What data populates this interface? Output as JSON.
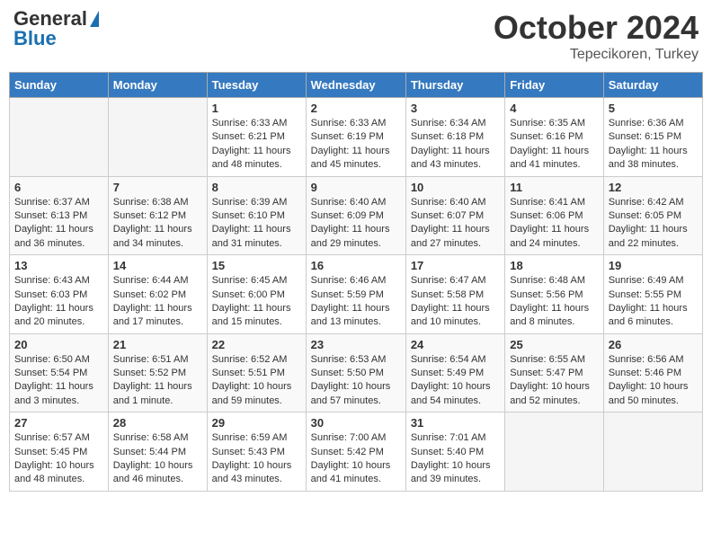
{
  "header": {
    "logo_general": "General",
    "logo_blue": "Blue",
    "month": "October 2024",
    "location": "Tepecikoren, Turkey"
  },
  "days_of_week": [
    "Sunday",
    "Monday",
    "Tuesday",
    "Wednesday",
    "Thursday",
    "Friday",
    "Saturday"
  ],
  "weeks": [
    [
      {
        "day": "",
        "sunrise": "",
        "sunset": "",
        "daylight": ""
      },
      {
        "day": "",
        "sunrise": "",
        "sunset": "",
        "daylight": ""
      },
      {
        "day": "1",
        "sunrise": "Sunrise: 6:33 AM",
        "sunset": "Sunset: 6:21 PM",
        "daylight": "Daylight: 11 hours and 48 minutes."
      },
      {
        "day": "2",
        "sunrise": "Sunrise: 6:33 AM",
        "sunset": "Sunset: 6:19 PM",
        "daylight": "Daylight: 11 hours and 45 minutes."
      },
      {
        "day": "3",
        "sunrise": "Sunrise: 6:34 AM",
        "sunset": "Sunset: 6:18 PM",
        "daylight": "Daylight: 11 hours and 43 minutes."
      },
      {
        "day": "4",
        "sunrise": "Sunrise: 6:35 AM",
        "sunset": "Sunset: 6:16 PM",
        "daylight": "Daylight: 11 hours and 41 minutes."
      },
      {
        "day": "5",
        "sunrise": "Sunrise: 6:36 AM",
        "sunset": "Sunset: 6:15 PM",
        "daylight": "Daylight: 11 hours and 38 minutes."
      }
    ],
    [
      {
        "day": "6",
        "sunrise": "Sunrise: 6:37 AM",
        "sunset": "Sunset: 6:13 PM",
        "daylight": "Daylight: 11 hours and 36 minutes."
      },
      {
        "day": "7",
        "sunrise": "Sunrise: 6:38 AM",
        "sunset": "Sunset: 6:12 PM",
        "daylight": "Daylight: 11 hours and 34 minutes."
      },
      {
        "day": "8",
        "sunrise": "Sunrise: 6:39 AM",
        "sunset": "Sunset: 6:10 PM",
        "daylight": "Daylight: 11 hours and 31 minutes."
      },
      {
        "day": "9",
        "sunrise": "Sunrise: 6:40 AM",
        "sunset": "Sunset: 6:09 PM",
        "daylight": "Daylight: 11 hours and 29 minutes."
      },
      {
        "day": "10",
        "sunrise": "Sunrise: 6:40 AM",
        "sunset": "Sunset: 6:07 PM",
        "daylight": "Daylight: 11 hours and 27 minutes."
      },
      {
        "day": "11",
        "sunrise": "Sunrise: 6:41 AM",
        "sunset": "Sunset: 6:06 PM",
        "daylight": "Daylight: 11 hours and 24 minutes."
      },
      {
        "day": "12",
        "sunrise": "Sunrise: 6:42 AM",
        "sunset": "Sunset: 6:05 PM",
        "daylight": "Daylight: 11 hours and 22 minutes."
      }
    ],
    [
      {
        "day": "13",
        "sunrise": "Sunrise: 6:43 AM",
        "sunset": "Sunset: 6:03 PM",
        "daylight": "Daylight: 11 hours and 20 minutes."
      },
      {
        "day": "14",
        "sunrise": "Sunrise: 6:44 AM",
        "sunset": "Sunset: 6:02 PM",
        "daylight": "Daylight: 11 hours and 17 minutes."
      },
      {
        "day": "15",
        "sunrise": "Sunrise: 6:45 AM",
        "sunset": "Sunset: 6:00 PM",
        "daylight": "Daylight: 11 hours and 15 minutes."
      },
      {
        "day": "16",
        "sunrise": "Sunrise: 6:46 AM",
        "sunset": "Sunset: 5:59 PM",
        "daylight": "Daylight: 11 hours and 13 minutes."
      },
      {
        "day": "17",
        "sunrise": "Sunrise: 6:47 AM",
        "sunset": "Sunset: 5:58 PM",
        "daylight": "Daylight: 11 hours and 10 minutes."
      },
      {
        "day": "18",
        "sunrise": "Sunrise: 6:48 AM",
        "sunset": "Sunset: 5:56 PM",
        "daylight": "Daylight: 11 hours and 8 minutes."
      },
      {
        "day": "19",
        "sunrise": "Sunrise: 6:49 AM",
        "sunset": "Sunset: 5:55 PM",
        "daylight": "Daylight: 11 hours and 6 minutes."
      }
    ],
    [
      {
        "day": "20",
        "sunrise": "Sunrise: 6:50 AM",
        "sunset": "Sunset: 5:54 PM",
        "daylight": "Daylight: 11 hours and 3 minutes."
      },
      {
        "day": "21",
        "sunrise": "Sunrise: 6:51 AM",
        "sunset": "Sunset: 5:52 PM",
        "daylight": "Daylight: 11 hours and 1 minute."
      },
      {
        "day": "22",
        "sunrise": "Sunrise: 6:52 AM",
        "sunset": "Sunset: 5:51 PM",
        "daylight": "Daylight: 10 hours and 59 minutes."
      },
      {
        "day": "23",
        "sunrise": "Sunrise: 6:53 AM",
        "sunset": "Sunset: 5:50 PM",
        "daylight": "Daylight: 10 hours and 57 minutes."
      },
      {
        "day": "24",
        "sunrise": "Sunrise: 6:54 AM",
        "sunset": "Sunset: 5:49 PM",
        "daylight": "Daylight: 10 hours and 54 minutes."
      },
      {
        "day": "25",
        "sunrise": "Sunrise: 6:55 AM",
        "sunset": "Sunset: 5:47 PM",
        "daylight": "Daylight: 10 hours and 52 minutes."
      },
      {
        "day": "26",
        "sunrise": "Sunrise: 6:56 AM",
        "sunset": "Sunset: 5:46 PM",
        "daylight": "Daylight: 10 hours and 50 minutes."
      }
    ],
    [
      {
        "day": "27",
        "sunrise": "Sunrise: 6:57 AM",
        "sunset": "Sunset: 5:45 PM",
        "daylight": "Daylight: 10 hours and 48 minutes."
      },
      {
        "day": "28",
        "sunrise": "Sunrise: 6:58 AM",
        "sunset": "Sunset: 5:44 PM",
        "daylight": "Daylight: 10 hours and 46 minutes."
      },
      {
        "day": "29",
        "sunrise": "Sunrise: 6:59 AM",
        "sunset": "Sunset: 5:43 PM",
        "daylight": "Daylight: 10 hours and 43 minutes."
      },
      {
        "day": "30",
        "sunrise": "Sunrise: 7:00 AM",
        "sunset": "Sunset: 5:42 PM",
        "daylight": "Daylight: 10 hours and 41 minutes."
      },
      {
        "day": "31",
        "sunrise": "Sunrise: 7:01 AM",
        "sunset": "Sunset: 5:40 PM",
        "daylight": "Daylight: 10 hours and 39 minutes."
      },
      {
        "day": "",
        "sunrise": "",
        "sunset": "",
        "daylight": ""
      },
      {
        "day": "",
        "sunrise": "",
        "sunset": "",
        "daylight": ""
      }
    ]
  ]
}
